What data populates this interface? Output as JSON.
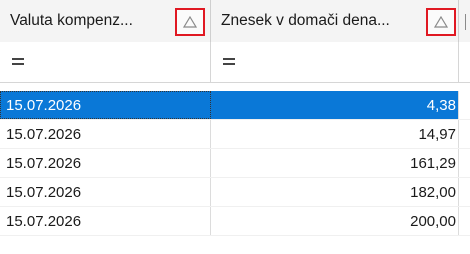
{
  "columns": [
    {
      "label": "Valuta kompenz...",
      "sort_icon": "sort-ascending-triangle"
    },
    {
      "label": "Znesek v domači dena...",
      "sort_icon": "sort-ascending-triangle"
    }
  ],
  "filter_symbol": "equals",
  "rows": [
    {
      "date": "15.07.2026",
      "amount": "4,38",
      "selected": true
    },
    {
      "date": "15.07.2026",
      "amount": "14,97",
      "selected": false
    },
    {
      "date": "15.07.2026",
      "amount": "161,29",
      "selected": false
    },
    {
      "date": "15.07.2026",
      "amount": "182,00",
      "selected": false
    },
    {
      "date": "15.07.2026",
      "amount": "200,00",
      "selected": false
    }
  ],
  "colors": {
    "selection": "#0a78d7",
    "sort_highlight": "#e01822",
    "header_bg": "#f4f4f4"
  }
}
